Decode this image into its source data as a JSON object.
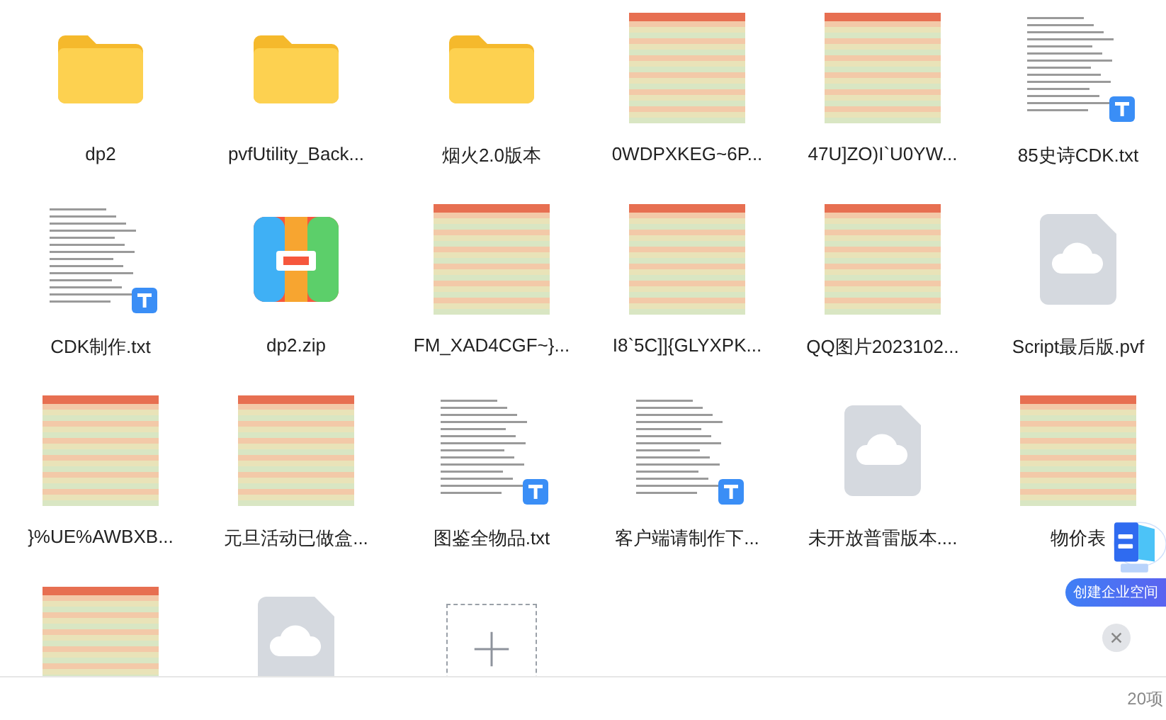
{
  "files": [
    {
      "kind": "folder",
      "name": "dp2"
    },
    {
      "kind": "folder",
      "name": "pvfUtility_Back..."
    },
    {
      "kind": "folder",
      "name": "烟火2.0版本"
    },
    {
      "kind": "image",
      "name": "0WDPXKEG~6P..."
    },
    {
      "kind": "image",
      "name": "47U]ZO)I`U0YW..."
    },
    {
      "kind": "text",
      "name": "85史诗CDK.txt"
    },
    {
      "kind": "text",
      "name": "CDK制作.txt"
    },
    {
      "kind": "zip",
      "name": "dp2.zip"
    },
    {
      "kind": "image",
      "name": "FM_XAD4CGF~}..."
    },
    {
      "kind": "image",
      "name": "I8`5C]]{GLYXPK..."
    },
    {
      "kind": "image",
      "name": "QQ图片2023102..."
    },
    {
      "kind": "cloud",
      "name": "Script最后版.pvf"
    },
    {
      "kind": "image",
      "name": "}%UE%AWBXB..."
    },
    {
      "kind": "image",
      "name": "元旦活动已做盒..."
    },
    {
      "kind": "text",
      "name": "图鉴全物品.txt"
    },
    {
      "kind": "text",
      "name": "客户端请制作下..."
    },
    {
      "kind": "cloud",
      "name": "未开放普雷版本...."
    },
    {
      "kind": "image",
      "name": "物价表"
    },
    {
      "kind": "image"
    },
    {
      "kind": "cloud"
    },
    {
      "kind": "add"
    }
  ],
  "promo": {
    "button": "创建企业空间"
  },
  "status_bar": {
    "count": "20项"
  }
}
